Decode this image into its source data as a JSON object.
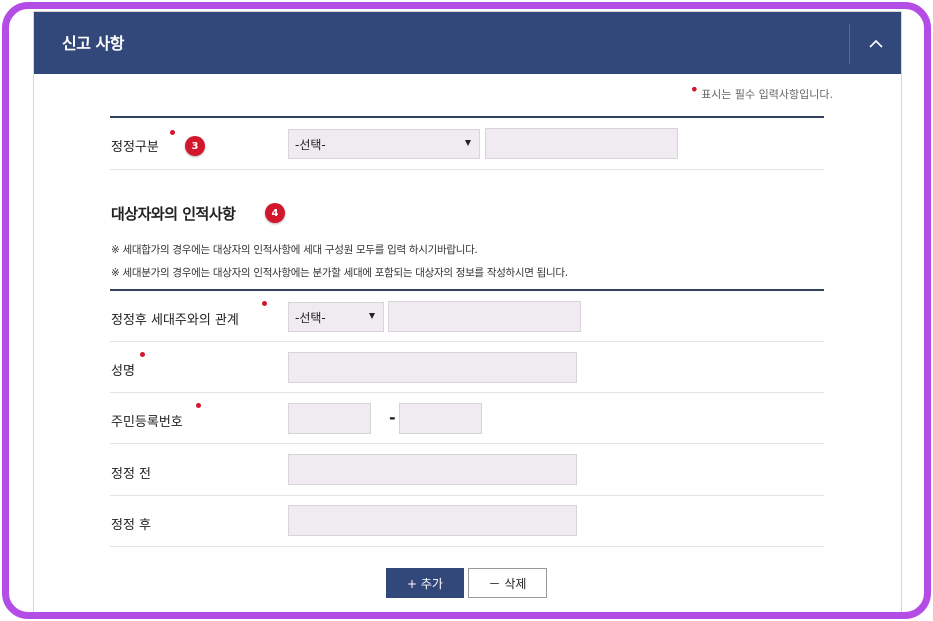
{
  "header": {
    "title": "신고 사항"
  },
  "required_note": "표시는 필수 입력사항입니다.",
  "correction_type": {
    "label": "정정구분",
    "badge": "3",
    "select_value": "-선택-"
  },
  "section": {
    "title": "대상자와의 인적사항",
    "badge": "4",
    "notes": [
      "※ 세대합가의 경우에는 대상자의 인적사항에 세대 구성원 모두를 입력 하시기바랍니다.",
      "※ 세대분가의 경우에는 대상자의 인적사항에는 분가할 세대에 포함되는 대상자의 정보를 작성하시면 됩니다."
    ]
  },
  "fields": {
    "relation_label": "정정후 세대주와의 관계",
    "relation_select": "-선택-",
    "name_label": "성명",
    "rrn_label": "주민등록번호",
    "rrn_dash": "-",
    "before_label": "정정 전",
    "after_label": "정정 후"
  },
  "buttons": {
    "add": "+ 추가",
    "delete": "－ 삭제"
  }
}
